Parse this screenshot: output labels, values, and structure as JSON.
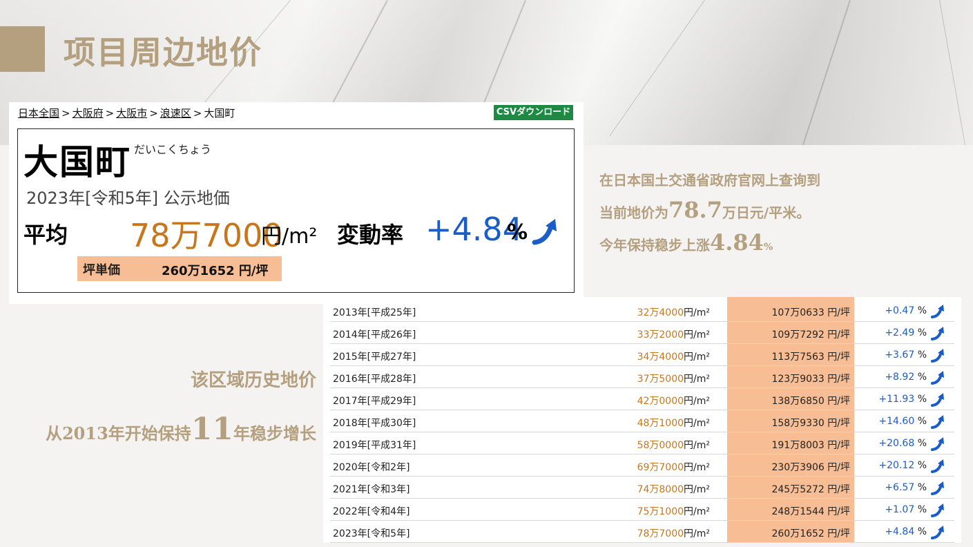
{
  "title": "项目周边地价",
  "breadcrumb": [
    "日本全国",
    "大阪府",
    "大阪市",
    "浪速区",
    "大国町"
  ],
  "csv_button": "CSVダウンロード",
  "town": {
    "name": "大国町",
    "kana": "だいこくちょう"
  },
  "year_label": "2023年[令和5年] 公示地価",
  "average": {
    "label": "平均",
    "price": "78万7000",
    "unit": "円/m²"
  },
  "rate": {
    "label": "変動率",
    "value": "+4.84",
    "unit": "%"
  },
  "tsubo": {
    "label": "坪単価",
    "value": "260万1652 円/坪"
  },
  "notes": {
    "line1": "在日本国土交通省政府官网上查询到",
    "line2_pre": "当前地价为",
    "line2_big": "78.7",
    "line2_post": "万日元/平米。",
    "line3_pre": "今年保持稳步上涨",
    "line3_big": "4.84",
    "line3_post": "%"
  },
  "left_notes": {
    "line1": "该区域历史地价",
    "line2_pre": "从2013年开始保持",
    "line2_big": "11",
    "line2_post": "年稳步增长"
  },
  "history": [
    {
      "year": "2013年[平成25年]",
      "price": "32万4000",
      "unit": "円/m²",
      "tsubo": "107万0633 円/坪",
      "rate": "+0.47",
      "rate_unit": "%"
    },
    {
      "year": "2014年[平成26年]",
      "price": "33万2000",
      "unit": "円/m²",
      "tsubo": "109万7292 円/坪",
      "rate": "+2.49",
      "rate_unit": "%"
    },
    {
      "year": "2015年[平成27年]",
      "price": "34万4000",
      "unit": "円/m²",
      "tsubo": "113万7563 円/坪",
      "rate": "+3.67",
      "rate_unit": "%"
    },
    {
      "year": "2016年[平成28年]",
      "price": "37万5000",
      "unit": "円/m²",
      "tsubo": "123万9033 円/坪",
      "rate": "+8.92",
      "rate_unit": "%"
    },
    {
      "year": "2017年[平成29年]",
      "price": "42万0000",
      "unit": "円/m²",
      "tsubo": "138万6850 円/坪",
      "rate": "+11.93",
      "rate_unit": "%"
    },
    {
      "year": "2018年[平成30年]",
      "price": "48万1000",
      "unit": "円/m²",
      "tsubo": "158万9330 円/坪",
      "rate": "+14.60",
      "rate_unit": "%"
    },
    {
      "year": "2019年[平成31年]",
      "price": "58万0000",
      "unit": "円/m²",
      "tsubo": "191万8003 円/坪",
      "rate": "+20.68",
      "rate_unit": "%"
    },
    {
      "year": "2020年[令和2年]",
      "price": "69万7000",
      "unit": "円/m²",
      "tsubo": "230万3906 円/坪",
      "rate": "+20.12",
      "rate_unit": "%"
    },
    {
      "year": "2021年[令和3年]",
      "price": "74万8000",
      "unit": "円/m²",
      "tsubo": "245万5272 円/坪",
      "rate": "+6.57",
      "rate_unit": "%"
    },
    {
      "year": "2022年[令和4年]",
      "price": "75万1000",
      "unit": "円/m²",
      "tsubo": "248万1544 円/坪",
      "rate": "+1.07",
      "rate_unit": "%"
    },
    {
      "year": "2023年[令和5年]",
      "price": "78万7000",
      "unit": "円/m²",
      "tsubo": "260万1652 円/坪",
      "rate": "+4.84",
      "rate_unit": "%"
    }
  ],
  "colors": {
    "gold": "#b4a07f",
    "orange": "#c8761c",
    "blue": "#1a5cc8",
    "peach": "#f7be95",
    "csv_green": "#1d8a43"
  }
}
